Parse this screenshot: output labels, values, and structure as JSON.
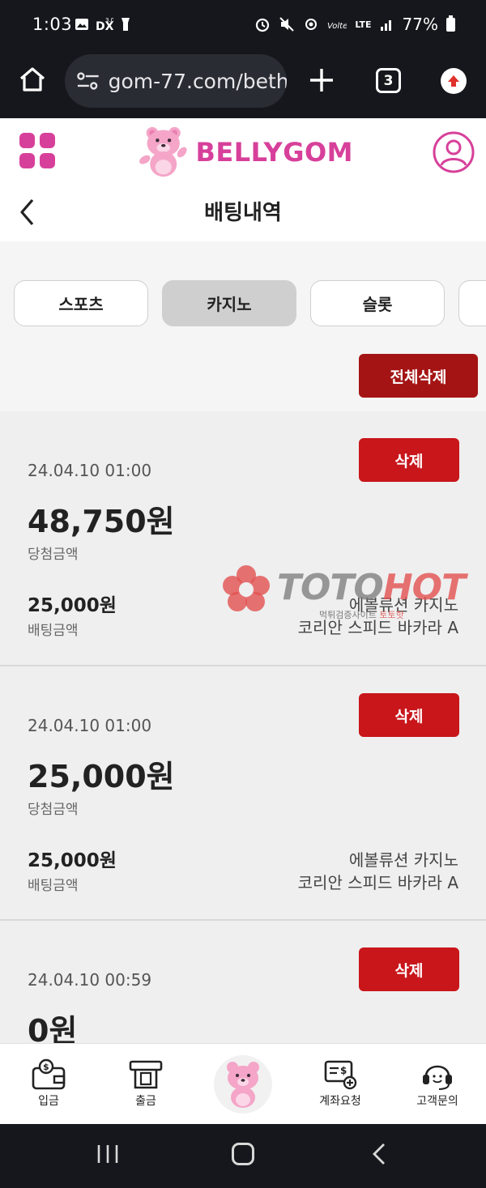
{
  "status_bar": {
    "time": "1:03",
    "network_type": "LTE",
    "battery_percent": "77%"
  },
  "browser": {
    "url": "gom-77.com/beth",
    "tab_count": "3"
  },
  "header": {
    "logo_text": "BELLYGOM",
    "page_title": "배팅내역"
  },
  "tabs": [
    {
      "label": "스포츠",
      "active": false
    },
    {
      "label": "카지노",
      "active": true
    },
    {
      "label": "슬롯",
      "active": false
    },
    {
      "label": "",
      "active": false
    }
  ],
  "delete_all_label": "전체삭제",
  "bets": [
    {
      "date": "24.04.10 01:00",
      "win_amount": "48,750원",
      "win_label": "당첨금액",
      "bet_amount": "25,000원",
      "bet_label": "배팅금액",
      "provider": "에볼류션 카지노",
      "game": "코리안 스피드 바카라 A",
      "delete_label": "삭제"
    },
    {
      "date": "24.04.10 01:00",
      "win_amount": "25,000원",
      "win_label": "당첨금액",
      "bet_amount": "25,000원",
      "bet_label": "배팅금액",
      "provider": "에볼류션 카지노",
      "game": "코리안 스피드 바카라 A",
      "delete_label": "삭제"
    },
    {
      "date": "24.04.10 00:59",
      "win_amount": "0원",
      "delete_label": "삭제"
    }
  ],
  "watermark": {
    "toto": "TOTO",
    "hot": "HOT",
    "sub_prefix": "먹튀검증사이트",
    "sub_suffix": "토토핫"
  },
  "bottom_nav": [
    {
      "label": "입금",
      "icon": "wallet-icon"
    },
    {
      "label": "출금",
      "icon": "atm-icon"
    },
    {
      "label": "",
      "icon": "bear-mascot-icon"
    },
    {
      "label": "계좌요청",
      "icon": "account-request-icon"
    },
    {
      "label": "고객문의",
      "icon": "headset-icon"
    }
  ],
  "colors": {
    "brand_pink": "#d7409a",
    "delete_red": "#c8161b",
    "delete_all_red": "#a41414",
    "card_bg": "#efefef"
  }
}
